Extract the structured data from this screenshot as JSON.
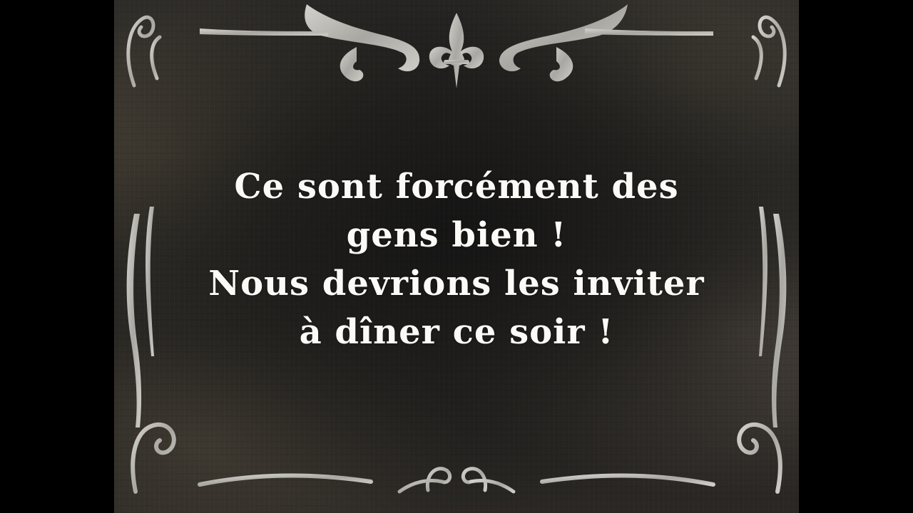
{
  "intertitle": {
    "lines": [
      "Ce sont forcément des",
      "gens bien !",
      "Nous devrions les inviter",
      "à dîner ce soir !"
    ]
  },
  "colors": {
    "background": "#000000",
    "card": "#222120",
    "text": "#fbfaf6",
    "ornament": "#b8b6b0"
  }
}
